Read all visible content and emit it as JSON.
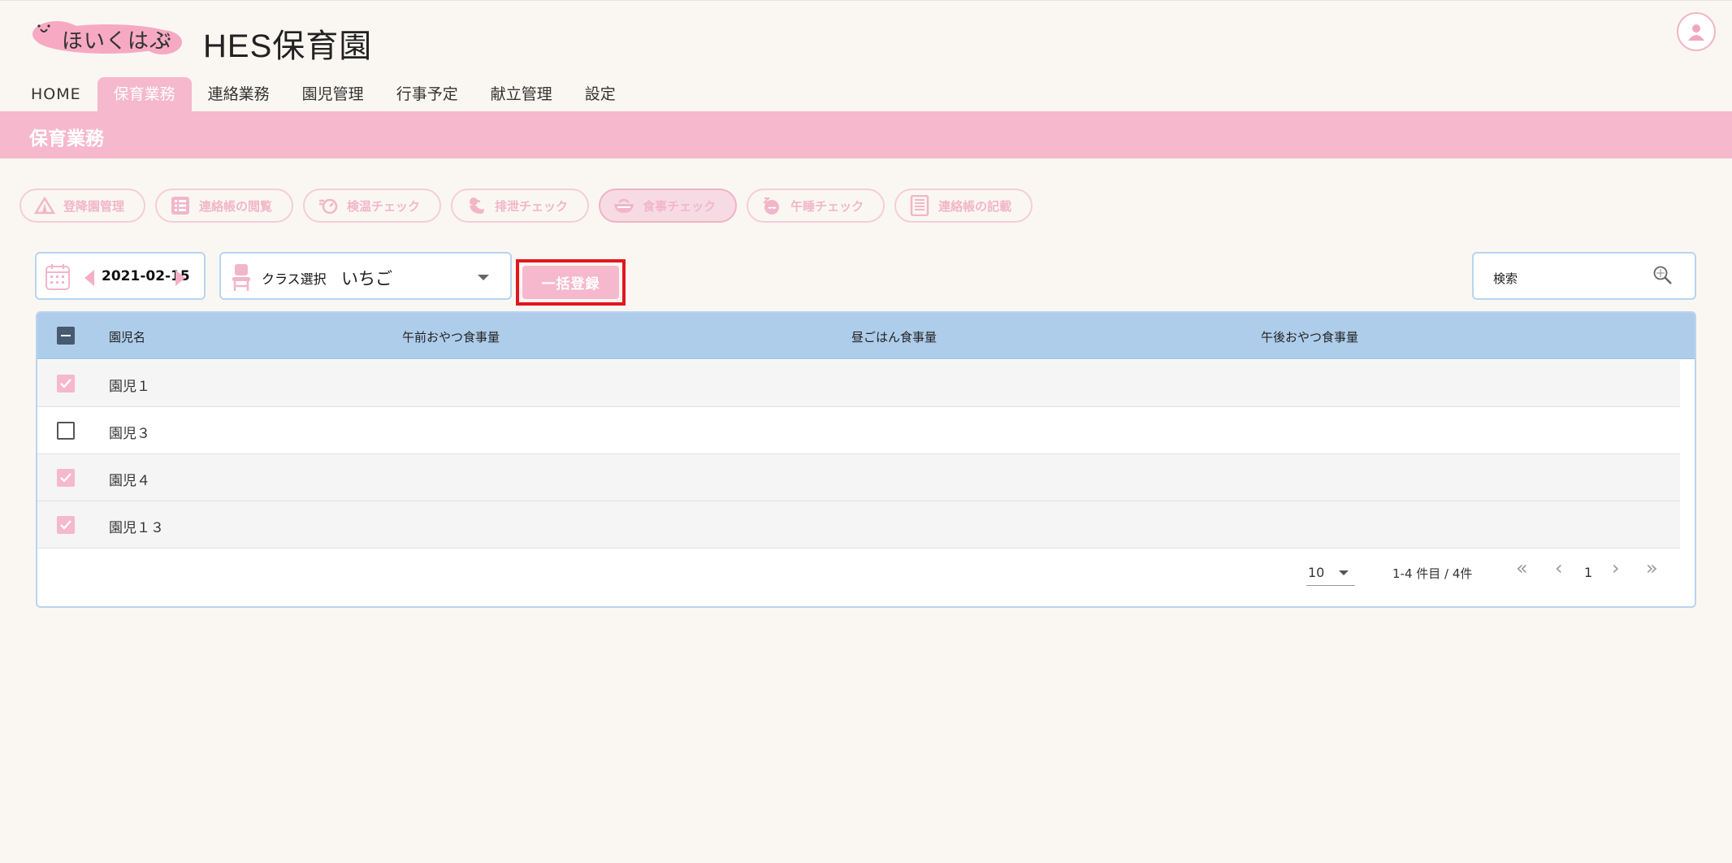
{
  "app": {
    "logo_text": "ほいくはぶ",
    "title": "HES保育園"
  },
  "nav": {
    "items": [
      {
        "label": "HOME"
      },
      {
        "label": "保育業務"
      },
      {
        "label": "連絡業務"
      },
      {
        "label": "園児管理"
      },
      {
        "label": "行事予定"
      },
      {
        "label": "献立管理"
      },
      {
        "label": "設定"
      }
    ],
    "active_index": 1
  },
  "section": {
    "title": "保育業務"
  },
  "submenu": {
    "items": [
      {
        "label": "登降園管理",
        "icon": "tent-icon"
      },
      {
        "label": "連絡帳の閲覧",
        "icon": "list-icon"
      },
      {
        "label": "検温チェック",
        "icon": "thermometer-icon"
      },
      {
        "label": "排泄チェック",
        "icon": "duck-icon"
      },
      {
        "label": "食事チェック",
        "icon": "bowl-icon"
      },
      {
        "label": "午睡チェック",
        "icon": "sleep-icon"
      },
      {
        "label": "連絡帳の記載",
        "icon": "notebook-icon"
      }
    ],
    "active_index": 4
  },
  "toolbar": {
    "date": "2021-02-15",
    "class_label": "クラス選択",
    "class_value": "いちご",
    "bulk_button": "一括登録",
    "search_placeholder": "検索"
  },
  "table": {
    "headers": [
      "園児名",
      "午前おやつ食事量",
      "昼ごはん食事量",
      "午後おやつ食事量"
    ],
    "rows": [
      {
        "name": "園児１",
        "checked": true
      },
      {
        "name": "園児３",
        "checked": false
      },
      {
        "name": "園児４",
        "checked": true
      },
      {
        "name": "園児１３",
        "checked": true
      }
    ]
  },
  "pagination": {
    "page_size": "10",
    "range_text": "1-4 件目 / 4件",
    "current_page": "1"
  },
  "colors": {
    "accent_pink": "#f5b8cc",
    "header_blue": "#aecdea",
    "highlight_red": "#e3161e"
  }
}
